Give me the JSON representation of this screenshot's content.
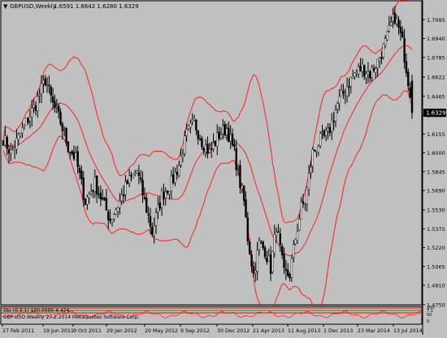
{
  "header": {
    "symbol_label": "GBPUSD,Weekly",
    "ohlc_text": "1.6591 1.6642 1.6280 1.6329"
  },
  "chart_data": {
    "type": "candlestick",
    "symbol": "GBPUSD",
    "timeframe": "Weekly",
    "last_price": 1.6329,
    "ylim": [
      1.475,
      1.725
    ],
    "price_ticks": [
      "1.7095",
      "1.6940",
      "1.6785",
      "1.6622",
      "1.6465",
      "1.6310",
      "1.6155",
      "1.6000",
      "1.5845",
      "1.5690",
      "1.5530",
      "1.5375",
      "1.5220",
      "1.5065",
      "1.4910",
      "1.4750"
    ],
    "date_ticks": [
      "27 Feb 2011",
      "19 Jun 2011",
      "9 Oct 2011",
      "29 Jan 2012",
      "20 May 2012",
      "9 Sep 2012",
      "30 Dec 2012",
      "21 Apr 2013",
      "11 Aug 2013",
      "1 Dec 2013",
      "23 Mar 2014",
      "13 Jul 2014"
    ],
    "close_anchors": [
      [
        0,
        1.612
      ],
      [
        4,
        1.6
      ],
      [
        8,
        1.612
      ],
      [
        12,
        1.625
      ],
      [
        17,
        1.64
      ],
      [
        22,
        1.66
      ],
      [
        26,
        1.64
      ],
      [
        30,
        1.625
      ],
      [
        34,
        1.605
      ],
      [
        38,
        1.595
      ],
      [
        43,
        1.56
      ],
      [
        48,
        1.575
      ],
      [
        52,
        1.56
      ],
      [
        56,
        1.545
      ],
      [
        61,
        1.56
      ],
      [
        65,
        1.575
      ],
      [
        70,
        1.585
      ],
      [
        74,
        1.56
      ],
      [
        78,
        1.535
      ],
      [
        83,
        1.565
      ],
      [
        88,
        1.575
      ],
      [
        92,
        1.59
      ],
      [
        96,
        1.615
      ],
      [
        100,
        1.625
      ],
      [
        104,
        1.61
      ],
      [
        108,
        1.6
      ],
      [
        113,
        1.615
      ],
      [
        117,
        1.62
      ],
      [
        121,
        1.6
      ],
      [
        124,
        1.575
      ],
      [
        126,
        1.56
      ],
      [
        128,
        1.53
      ],
      [
        131,
        1.5
      ],
      [
        134,
        1.525
      ],
      [
        137,
        1.52
      ],
      [
        140,
        1.505
      ],
      [
        143,
        1.54
      ],
      [
        147,
        1.5
      ],
      [
        150,
        1.5
      ],
      [
        153,
        1.53
      ],
      [
        156,
        1.555
      ],
      [
        158,
        1.56
      ],
      [
        162,
        1.6
      ],
      [
        166,
        1.61
      ],
      [
        170,
        1.615
      ],
      [
        175,
        1.64
      ],
      [
        180,
        1.655
      ],
      [
        184,
        1.665
      ],
      [
        188,
        1.67
      ],
      [
        192,
        1.665
      ],
      [
        196,
        1.675
      ],
      [
        200,
        1.69
      ],
      [
        203,
        1.705
      ],
      [
        205,
        1.712
      ],
      [
        207,
        1.702
      ],
      [
        209,
        1.69
      ],
      [
        211,
        1.67
      ],
      [
        213,
        1.65
      ],
      [
        214,
        1.6329
      ]
    ],
    "bollinger_bands": {
      "period": 20,
      "deviations": 2,
      "color": "#ff2020"
    },
    "colors": {
      "background": "#c0c0c0",
      "bull_candle": "#e8e8e8",
      "bear_candle": "#000000",
      "wick": "#000000",
      "band": "#ff2020",
      "price_badge": "#000000",
      "price_badge_text": "#ffffff"
    },
    "grid": false
  },
  "indicator": {
    "label": "Sto (0.3.1) 100.0000 4.424 -"
  },
  "status": {
    "text": "GBP USD,Weekly 27.2.2014 MetaQuotes Software Corp."
  },
  "subpanel_ticks": [
    "100",
    "7.1",
    "50",
    "0"
  ]
}
